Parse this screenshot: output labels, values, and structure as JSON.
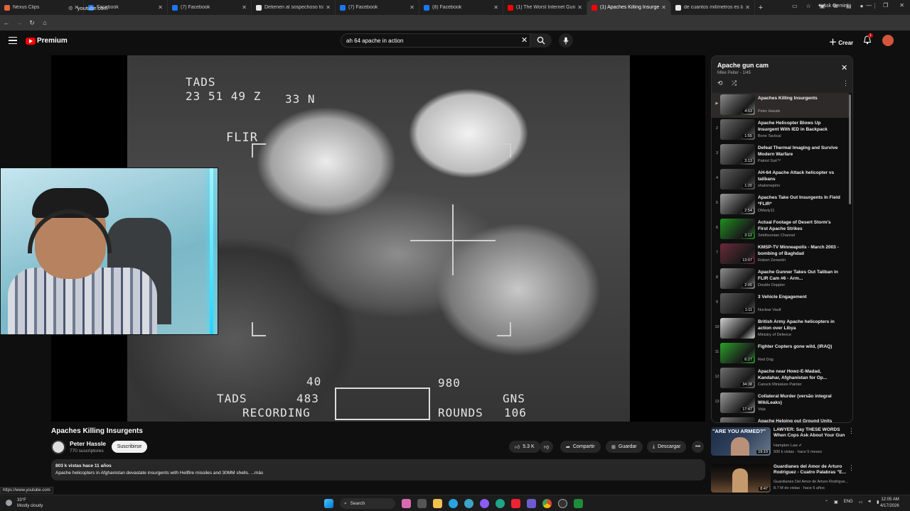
{
  "browser": {
    "tabs": [
      {
        "label": "Nexus Clips",
        "color": "#e0643c",
        "active": false
      },
      {
        "label": "Facebook",
        "color": "#1877f2",
        "active": false
      },
      {
        "label": "(7) Facebook",
        "color": "#1877f2",
        "active": false
      },
      {
        "label": "Detienen al sospechoso tras un",
        "color": "#e8e8e8",
        "active": false
      },
      {
        "label": "(7) Facebook",
        "color": "#1877f2",
        "active": false
      },
      {
        "label": "(8) Facebook",
        "color": "#1877f2",
        "active": false
      },
      {
        "label": "(1) The Worst Internet Gun Fails",
        "color": "#ff0000",
        "active": false
      },
      {
        "label": "(1) Apaches Killing Insurgents",
        "color": "#ff0000",
        "active": true
      },
      {
        "label": "de cuantos milímetros es la m...",
        "color": "#e8e8e8",
        "active": false
      }
    ],
    "ask_gemini": "Ask Gemini",
    "url": "youtube.com",
    "hover_url": "https://www.youtube.com"
  },
  "header": {
    "logo_text": "Premium",
    "search_value": "ah 64 apache in action",
    "create_label": "Crear",
    "notif_count": "1"
  },
  "video": {
    "hud": {
      "tads_top": "TADS",
      "time": "23 51 49 Z",
      "lat": "33  N",
      "flir": "FLIR",
      "bottom_num": "40",
      "tads_bot": "TADS",
      "val483": "483",
      "recording": "RECORDING",
      "v980": "980",
      "rounds": "ROUNDS",
      "gns": "GNS",
      "v106": "106"
    },
    "title": "Apaches Killing Insurgents",
    "channel": "Peter Hassle",
    "subs": "770 suscriptores",
    "subscribe": "Suscribirse",
    "likes": "5.3 K",
    "share": "Compartir",
    "save": "Guardar",
    "download": "Descargar",
    "stats": "803 k vistas  hace 11 años",
    "description": "Apache helicopters in Afghanistan devastate insurgents with Hellfire missiles and 30MM shells.  ...más"
  },
  "playlist": {
    "title": "Apache gun cam",
    "sub": "Mike Peiter - 1/45",
    "items": [
      {
        "idx": "▶",
        "title": "Apaches Killing Insurgents",
        "channel": "Peter Hassle",
        "dur": "4:53",
        "tone": "#8a8a8a"
      },
      {
        "idx": "2",
        "title": "Apache Helicopter Blows Up Insurgent With IED in Backpack",
        "channel": "Bone Tactical",
        "dur": "1:55",
        "tone": "#6a6a6a"
      },
      {
        "idx": "3",
        "title": "Defeat Thermal Imaging and Survive Modern Warfare",
        "channel": "Patriot Suit™",
        "dur": "3:13",
        "tone": "#7a7a7a"
      },
      {
        "idx": "4",
        "title": "AH-64 Apache Attack helicopter vs talibans",
        "channel": "shalomejohn",
        "dur": "1:20",
        "tone": "#5c5c5c"
      },
      {
        "idx": "5",
        "title": "Apaches Take Out Insurgents In Field *FLIR*",
        "channel": "DMarty11",
        "dur": "2:54",
        "tone": "#9a9a9a"
      },
      {
        "idx": "6",
        "title": "Actual Footage of Desert Storm's First Apache Strikes",
        "channel": "Smithsonian Channel",
        "dur": "3:12",
        "tone": "#1f8f1f"
      },
      {
        "idx": "7",
        "title": "KMSP-TV Minneapolis - March 2003 - bombing of Baghdad",
        "channel": "Robert Zerwekh",
        "dur": "13:07",
        "tone": "#6b2a3a"
      },
      {
        "idx": "8",
        "title": "Apache Gunner Takes Out Taliban in FLIR Cam #6 - Arm...",
        "channel": "Double Doppler",
        "dur": "2:00",
        "tone": "#8d8d8d"
      },
      {
        "idx": "9",
        "title": "3 Vehicle Engagement",
        "channel": "Nuclear Vault",
        "dur": "1:11",
        "tone": "#5a5a5a"
      },
      {
        "idx": "10",
        "title": "British Army Apache helicopters in action over Libya",
        "channel": "Ministry of Defence",
        "dur": "",
        "tone": "#cfcfcf"
      },
      {
        "idx": "11",
        "title": "Fighter Copters gone wild, (IRAQ)",
        "channel": "Red Dog",
        "dur": "6:27",
        "tone": "#2aa02a"
      },
      {
        "idx": "12",
        "title": "Apache near Howz-E-Madad, Kandahar, Afghanistan for Op...",
        "channel": "Canuck Miniature Painter",
        "dur": "34:38",
        "tone": "#6f6f6f"
      },
      {
        "idx": "13",
        "title": "Collateral Murder (versão integral WikiLeaks)",
        "channel": "Veja",
        "dur": "17:47",
        "tone": "#9a9a9a"
      },
      {
        "idx": "14",
        "title": "Apache Helping out Ground Units",
        "channel": "",
        "dur": "",
        "tone": "#777"
      }
    ]
  },
  "recs": [
    {
      "title": "LAWYER: Say THESE WORDS When Cops Ask About Your Gun",
      "channel": "Hampton Law",
      "meta": "930 k vistas · hace 5 meses",
      "dur": "19:10",
      "thumb_text": "\"ARE YOU ARMED?\""
    },
    {
      "title": "Guardianes del Amor de Arturo Rodriguez - Cuatro Palabras \"E...",
      "channel": "Guardianes Del Amor de Arturo Rodrígue...",
      "meta": "8.7 M de vistas · hace 6 años",
      "dur": "8:47",
      "thumb_text": ""
    }
  ],
  "taskbar": {
    "temp": "33°F",
    "weather": "Mostly cloudy",
    "search": "Search",
    "lang": "ENG",
    "time": "12:05 AM",
    "date": "4/17/2026"
  }
}
